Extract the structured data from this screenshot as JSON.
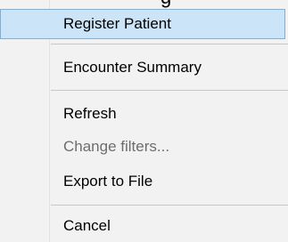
{
  "window": {
    "title_fragment": "g"
  },
  "context_menu": {
    "items": [
      {
        "label": "Register Patient",
        "state": "highlighted"
      },
      {
        "label": "Encounter Summary",
        "state": "normal"
      },
      {
        "label": "Refresh",
        "state": "normal"
      },
      {
        "label": "Change filters...",
        "state": "disabled"
      },
      {
        "label": "Export to File",
        "state": "normal"
      },
      {
        "label": "Cancel",
        "state": "normal"
      }
    ]
  },
  "colors": {
    "menu_background": "#f2f2f2",
    "highlight_background": "#cce4f7",
    "highlight_border": "#7fb0d8",
    "disabled_text": "#6d6d6d",
    "separator": "#c8c8c8"
  }
}
